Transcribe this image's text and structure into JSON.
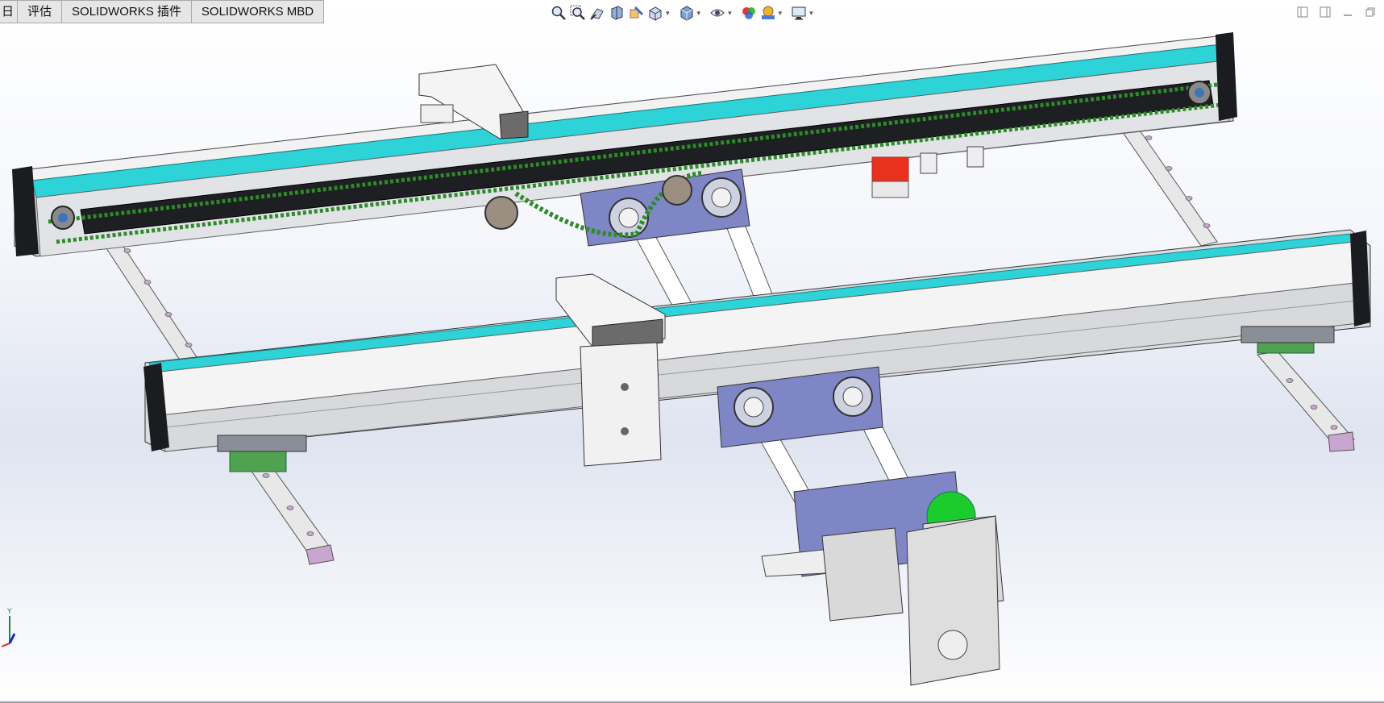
{
  "window": {
    "tabs": [
      {
        "label": "日"
      },
      {
        "label": "评估"
      },
      {
        "label": "SOLIDWORKS 插件"
      },
      {
        "label": "SOLIDWORKS MBD"
      }
    ]
  },
  "heads_up_toolbar": {
    "icons": [
      "zoom-to-fit-icon",
      "zoom-to-area-icon",
      "previous-view-icon",
      "section-view-icon",
      "dynamic-annotation-icon",
      "view-orientation-icon",
      "display-style-icon",
      "hide-show-items-icon",
      "edit-appearance-icon",
      "apply-scene-icon",
      "view-settings-icon"
    ]
  },
  "window_controls": {
    "icons": [
      "tile-left-icon",
      "tile-right-icon",
      "minimize-icon",
      "restore-icon"
    ]
  },
  "triad": {
    "y_label": "Y"
  },
  "colors": {
    "accent_cyan": "#2ed3d8",
    "chain_green": "#2f8a2a",
    "bearing_blue": "#7f86c6",
    "motor_green": "#1ccc2c",
    "sensor_red": "#e8321e",
    "rail_pink": "#c9a6cf"
  }
}
